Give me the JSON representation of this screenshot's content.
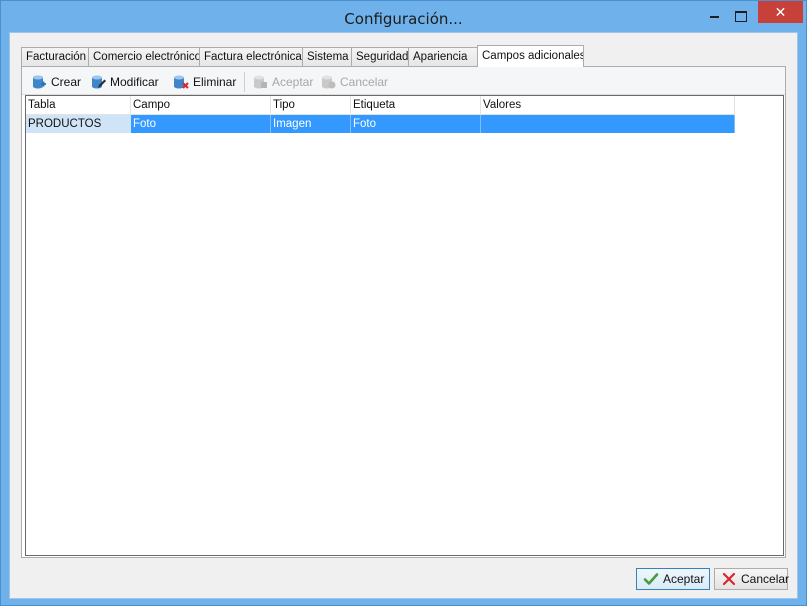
{
  "window": {
    "title": "Configuración...",
    "close_glyph": "✕"
  },
  "tabs": [
    {
      "label": "Facturación"
    },
    {
      "label": "Comercio electrónico"
    },
    {
      "label": "Factura electrónica"
    },
    {
      "label": "Sistema"
    },
    {
      "label": "Seguridad"
    },
    {
      "label": "Apariencia"
    },
    {
      "label": "Campos adicionales",
      "active": true
    }
  ],
  "toolbar": {
    "crear": "Crear",
    "modificar": "Modificar",
    "eliminar": "Eliminar",
    "aceptar": "Aceptar",
    "cancelar": "Cancelar"
  },
  "table": {
    "columns": [
      "Tabla",
      "Campo",
      "Tipo",
      "Etiqueta",
      "Valores"
    ],
    "rows": [
      [
        "PRODUCTOS",
        "Foto",
        "Imagen",
        "Foto",
        ""
      ]
    ]
  },
  "footer": {
    "aceptar": "Aceptar",
    "cancelar": "Cancelar"
  },
  "colors": {
    "accent": "#3399ff",
    "title_bar": "#6fb1ea",
    "close": "#c7413a"
  },
  "icons": {
    "crear": "database-add-icon",
    "modificar": "database-edit-icon",
    "eliminar": "database-delete-icon",
    "aceptar": "database-save-icon",
    "cancelar": "database-cancel-icon",
    "footer_aceptar": "checkmark-icon",
    "footer_cancelar": "x-icon"
  }
}
